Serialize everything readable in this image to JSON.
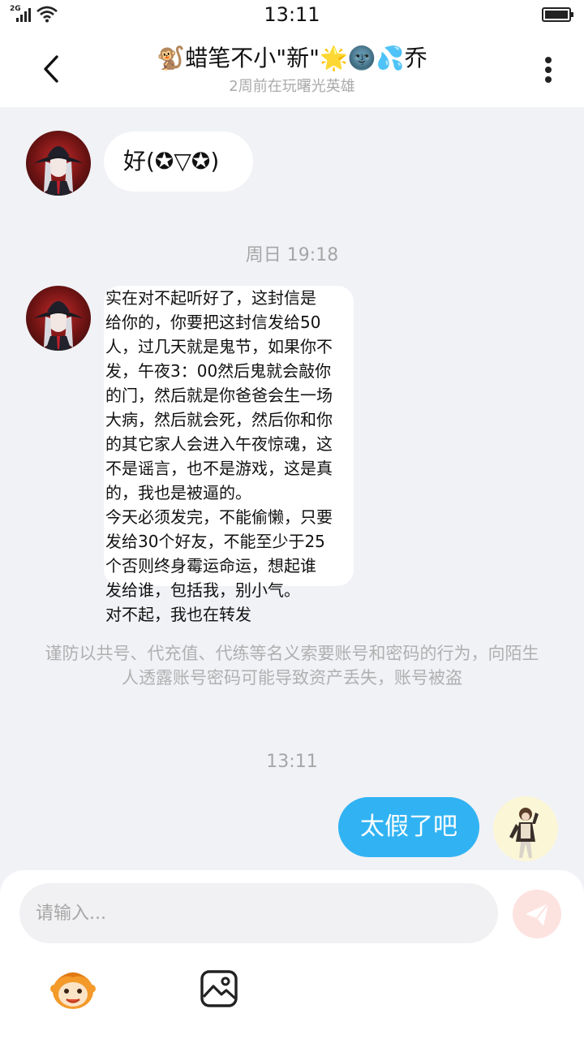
{
  "status_bar": {
    "network": "2G",
    "time": "13:11",
    "icons": [
      "signal-icon",
      "wifi-icon",
      "battery-icon"
    ]
  },
  "header": {
    "title": "🐒蜡笔不小\"新\"🌟🌚💦乔",
    "subtitle": "2周前在玩曙光英雄",
    "icons": [
      "back-arrow-icon",
      "more-vertical-icon"
    ]
  },
  "messages": [
    {
      "side": "incoming",
      "avatar": "contact-avatar",
      "text": "好(✪▽✪)"
    },
    {
      "type": "timestamp",
      "text": "周日 19:18"
    },
    {
      "side": "incoming",
      "avatar": "contact-avatar",
      "text": "实在对不起听好了，这封信是\n给你的，你要把这封信发给50\n人，过几天就是鬼节，如果你不\n发，午夜3：00然后鬼就会敲你\n的门，然后就是你爸爸会生一场\n大病，然后就会死，然后你和你\n的其它家人会进入午夜惊魂，这\n不是谣言，也不是游戏，这是真\n的，我也是被逼的。\n今天必须发完，不能偷懒，只要\n发给30个好友，不能至少于25\n个否则终身霉运命运，想起谁\n发给谁，包括我，别小气。\n对不起，我也在转发"
    },
    {
      "type": "notice",
      "text": "谨防以共号、代充值、代练等名义索要账号和密码的行为，向陌生人透露账号密码可能导致资产丢失，账号被盗"
    },
    {
      "type": "timestamp",
      "text": "13:11"
    },
    {
      "side": "outgoing",
      "avatar": "self-avatar",
      "text": "太假了吧"
    }
  ],
  "composer": {
    "placeholder": "请输入...",
    "icons": [
      "send-icon",
      "emoji-icon",
      "image-icon"
    ]
  },
  "colors": {
    "background": "#f1f2f6",
    "outgoing_bubble": "#31b3f3",
    "incoming_bubble": "#ffffff",
    "send_button": "#fde3e0",
    "accent_orange": "#f39a2b"
  }
}
